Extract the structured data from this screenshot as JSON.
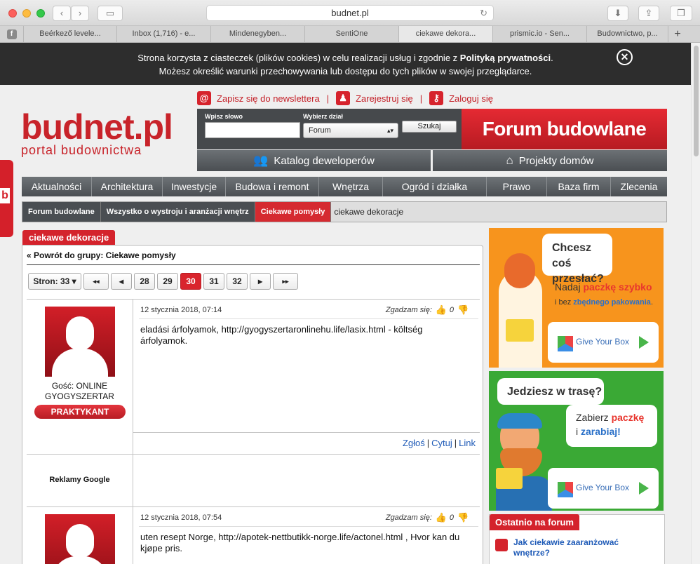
{
  "browser": {
    "url": "budnet.pl",
    "tabs": [
      "Beérkező levele...",
      "Inbox (1,716) - e...",
      "Mindenegyben...",
      "SentiOne",
      "ciekawe dekora...",
      "prismic.io - Sen...",
      "Budownictwo, p..."
    ],
    "active_tab": 4,
    "favicon_letter": "f",
    "new_tab": "+"
  },
  "cookie": {
    "line1_pre": "Strona korzysta z ciasteczek (plików cookies) w celu realizacji usług i zgodnie z ",
    "line1_link": "Polityką prywatności",
    "line1_post": ".",
    "line2": "Możesz określić warunki przechowywania lub dostępu do tych plików w swojej przeglądarce.",
    "close": "✕"
  },
  "header": {
    "newsletter": "Zapisz się do newslettera",
    "register": "Zarejestruj się",
    "login": "Zaloguj się",
    "sep": "|",
    "logo_main": "budnet.pl",
    "logo_sub": "portal budownictwa",
    "search_label_word": "Wpisz słowo",
    "search_label_section": "Wybierz dział",
    "search_section_value": "Forum",
    "search_button": "Szukaj",
    "forum_button": "Forum budowlane",
    "catalog_button": "Katalog deweloperów",
    "projects_button": "Projekty domów"
  },
  "nav": [
    "Aktualności",
    "Architektura",
    "Inwestycje",
    "Budowa i remont",
    "Wnętrza",
    "Ogród i działka",
    "Prawo",
    "Baza firm",
    "Zlecenia"
  ],
  "breadcrumbs": {
    "items": [
      "Forum budowlane",
      "Wszystko o wystroju i aranżacji wnętrz",
      "Ciekawe pomysły"
    ],
    "current": "ciekawe dekoracje"
  },
  "topic": {
    "title": "ciekawe dekoracje",
    "back_link": "« Powrót do grupy: Ciekawe pomysły",
    "pager": {
      "pages_label": "Stron: 33 ▾",
      "first": "◂◂",
      "prev": "◂",
      "pages": [
        "28",
        "29",
        "30",
        "31",
        "32"
      ],
      "current": "30",
      "next": "▸",
      "last": "▸▸"
    }
  },
  "posts": [
    {
      "date": "12 stycznia 2018, 07:14",
      "agree_label": "Zgadzam się:",
      "agree_count": "0",
      "author_line1": "Gość: ONLINE",
      "author_line2": "GYOGYSZERTAR",
      "rank": "PRAKTYKANT",
      "text": "eladási árfolyamok, http://gyogyszertaronlinehu.life/lasix.html - költség árfolyamok.",
      "actions": [
        "Zgłoś",
        "Cytuj",
        "Link"
      ]
    },
    {
      "date": "12 stycznia 2018, 07:54",
      "agree_label": "Zgadzam się:",
      "agree_count": "0",
      "text": "uten resept Norge, http://apotek-nettbutikk-norge.life/actonel.html , Hvor kan du kjøpe pris."
    }
  ],
  "google_ads_label": "Reklamy Google",
  "ads": {
    "ad1": {
      "question_l1": "Chcesz coś",
      "question_l2": "przesłać?",
      "tag_l1_pre": "Nadaj ",
      "tag_l1_hl": "paczkę szybko",
      "tag_l2_pre": "i bez ",
      "tag_l2_hl": "zbędnego pakowania",
      "tag_l2_post": ".",
      "brand": "Give Your Box"
    },
    "ad2": {
      "question": "Jedziesz w trasę?",
      "tag_l1_pre": "Zabierz ",
      "tag_l1_hl": "paczkę",
      "tag_l2_pre": "i ",
      "tag_l2_hl": "zarabiaj!",
      "brand": "Give Your Box"
    }
  },
  "recent": {
    "header": "Ostatnio na forum",
    "item_l1": "Jak ciekawie zaaranżować",
    "item_l2": "wnętrze?"
  },
  "colors": {
    "brand_red": "#d4232c",
    "dark_gray": "#4a4e52",
    "ad_orange": "#f7941d",
    "ad_green": "#3aa935"
  }
}
